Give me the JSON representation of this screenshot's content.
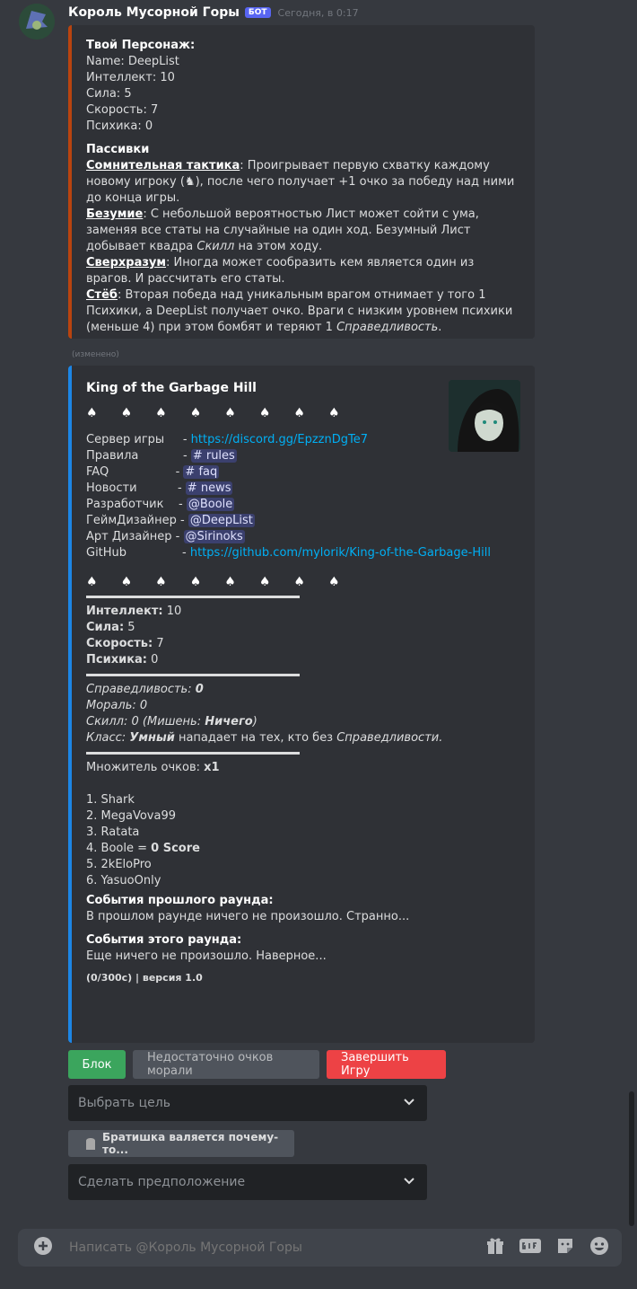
{
  "message": {
    "username": "Король Мусорной Горы",
    "badge": "БОТ",
    "timestamp": "Сегодня, в 0:17",
    "edited_label": "(изменено)"
  },
  "embed1": {
    "heading": "Твой Персонаж:",
    "name_line": "Name: DeepList",
    "stats": [
      "Интеллект: 10",
      "Сила: 5",
      "Скорость: 7",
      "Психика: 0"
    ],
    "passives_heading": "Пассивки",
    "p1_name": "Сомнительная тактика",
    "p1_text": ": Проигрывает первую схватку каждому новому игроку (♞), после чего получает +1 очко за победу над ними до конца игры.",
    "p2_name": "Безумие",
    "p2_text_a": ": С небольшой вероятностью Лист может сойти с ума, заменяя все статы на случайные на один ход. Безумный Лист добывает квадра ",
    "p2_italic": "Скилл",
    "p2_text_b": " на этом ходу.",
    "p3_name": "Сверхразум",
    "p3_text": ": Иногда может сообразить кем является один из врагов. И рассчитать его статы.",
    "p4_name": "Стёб",
    "p4_text_a": ": Вторая победа над уникальным врагом отнимает у того 1 Психики, а DeepList получает очко. Враги с низким уровнем психики (меньше 4) при этом бомбят и теряют 1 ",
    "p4_italic": "Справедливость",
    "p4_text_b": "."
  },
  "embed2": {
    "title": "King of the Garbage Hill",
    "helmet_glyph": "♠",
    "links": {
      "server_label": "Сервер игры",
      "server_url": "https://discord.gg/EpzznDgTe7",
      "rules_label": "Правила",
      "rules_channel": "rules",
      "faq_label": "FAQ",
      "faq_channel": "faq",
      "news_label": "Новости",
      "news_channel": "news",
      "dev_label": "Разработчик",
      "dev_mention": "@Boole",
      "gd_label": "ГеймДизайнер",
      "gd_mention": "@DeepList",
      "art_label": "Арт Дизайнер",
      "art_mention": "@Sirinoks",
      "github_label": "GitHub",
      "github_url": "https://github.com/mylorik/King-of-the-Garbage-Hill"
    },
    "stat_rows": [
      {
        "label": "Интеллект:",
        "value": "10"
      },
      {
        "label": "Сила:",
        "value": "5"
      },
      {
        "label": "Скорость:",
        "value": "7"
      },
      {
        "label": "Психика:",
        "value": "0"
      }
    ],
    "justice_label": "Справедливость: ",
    "justice_value": "0",
    "morale": "Мораль: 0",
    "skill_a": "Скилл: 0 (Мишень: ",
    "skill_target": "Ничего",
    "skill_b": ")",
    "class_label": "Класс: ",
    "class_value": "Умный",
    "class_text": " нападает на тех, кто без ",
    "class_italic": "Справедливости",
    "class_end": ".",
    "multiplier_label": "Множитель очков: ",
    "multiplier_value": "x1",
    "leaderboard": [
      "1. Shark",
      "2. MegaVova99",
      "3. Ratata"
    ],
    "lb4_a": "4. Boole = ",
    "lb4_b": "0 Score",
    "leaderboard2": [
      "5. 2kEloPro",
      "6. YasuoOnly"
    ],
    "prev_heading": "События прошлого раунда:",
    "prev_text": "В прошлом раунде ничего не произошло. Странно...",
    "cur_heading": "События этого раунда:",
    "cur_text": "Еще ничего не произошло. Наверное...",
    "footer": "(0/300с) | версия 1.0"
  },
  "buttons": {
    "block": "Блок",
    "not_enough": "Недостаточно очков морали",
    "end_game": "Завершить Игру"
  },
  "select1": {
    "placeholder": "Выбрать цель"
  },
  "small_button": {
    "label": "Братишка валяется почему-то..."
  },
  "select2": {
    "placeholder": "Сделать предположение"
  },
  "composer": {
    "placeholder": "Написать @Король Мусорной Горы"
  },
  "colors": {
    "accent1": "#b9440f",
    "accent2": "#1c86e6",
    "green": "#3ba55d",
    "red": "#ed4245"
  }
}
